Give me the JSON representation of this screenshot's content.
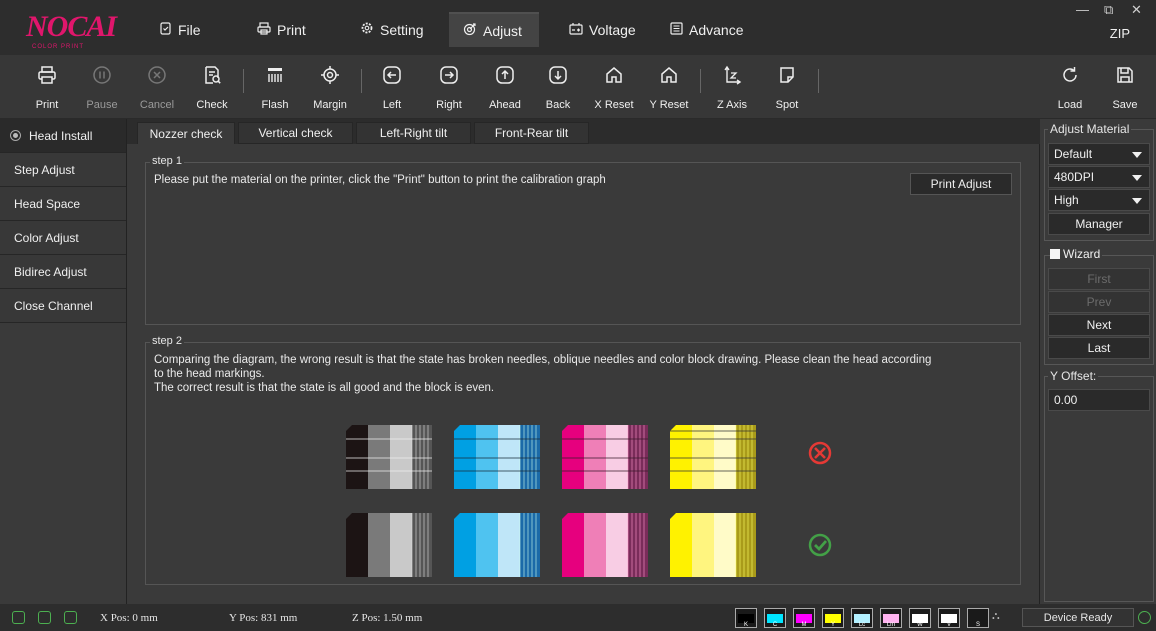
{
  "app": {
    "logo": "NOCAI",
    "logo_sub": "COLOR PRINT",
    "zip": "ZIP",
    "minimize": "—",
    "maximize": "⧉",
    "close": "✕"
  },
  "menu": [
    {
      "label": "File",
      "icon": "file-icon"
    },
    {
      "label": "Print",
      "icon": "printer-icon"
    },
    {
      "label": "Setting",
      "icon": "gear-icon"
    },
    {
      "label": "Adjust",
      "icon": "adjust-icon"
    },
    {
      "label": "Voltage",
      "icon": "voltage-icon"
    },
    {
      "label": "Advance",
      "icon": "advance-icon"
    }
  ],
  "toolbar": {
    "print": "Print",
    "pause": "Pause",
    "cancel": "Cancel",
    "check": "Check",
    "flash": "Flash",
    "margin": "Margin",
    "left": "Left",
    "right": "Right",
    "ahead": "Ahead",
    "back": "Back",
    "x_reset": "X Reset",
    "y_reset": "Y Reset",
    "z_axis": "Z Axis",
    "spot": "Spot",
    "load": "Load",
    "save": "Save"
  },
  "sidebar": {
    "items": [
      {
        "label": "Head Install"
      },
      {
        "label": "Step Adjust"
      },
      {
        "label": "Head Space"
      },
      {
        "label": "Color Adjust"
      },
      {
        "label": "Bidirec Adjust"
      },
      {
        "label": "Close Channel"
      }
    ]
  },
  "tabs": [
    "Nozzer check",
    "Vertical check",
    "Left-Right tilt",
    "Front-Rear tilt"
  ],
  "step1": {
    "title": "step 1",
    "text": "Please put the material on the printer, click the \"Print\" button to print the calibration graph",
    "button": "Print Adjust"
  },
  "step2": {
    "title": "step 2",
    "line1": "Comparing the diagram, the wrong result is that the state has broken needles, oblique needles and color block drawing. Please clean the head according",
    "line2": "to the head markings.",
    "line3": "The correct result is that the state is all good and the block is even."
  },
  "right_panel": {
    "title": "Adjust Material",
    "material": "Default",
    "dpi": "480DPI",
    "quality": "High",
    "manager": "Manager",
    "wizard": "Wizard",
    "first": "First",
    "prev": "Prev",
    "next": "Next",
    "last": "Last",
    "y_offset_label": "Y Offset:",
    "y_offset_value": "0.00"
  },
  "status": {
    "x_pos": "X Pos: 0 mm",
    "y_pos": "Y Pos: 831 mm",
    "z_pos": "Z Pos: 1.50 mm",
    "device": "Device Ready",
    "inks": [
      {
        "label": "K",
        "color": "#000000"
      },
      {
        "label": "C",
        "color": "#00e5ff"
      },
      {
        "label": "M",
        "color": "#ff00ff"
      },
      {
        "label": "Y",
        "color": "#ffff00"
      },
      {
        "label": "Lc",
        "color": "#b3f0ff"
      },
      {
        "label": "Lm",
        "color": "#ffb3f0"
      },
      {
        "label": "W",
        "color": "#ffffff"
      },
      {
        "label": "V",
        "color": "#ffffff"
      },
      {
        "label": "S",
        "color": "#1a1a1a"
      }
    ]
  },
  "colors": {
    "accent": "#e0166c",
    "wrong": "#e53935",
    "correct": "#43a047"
  }
}
